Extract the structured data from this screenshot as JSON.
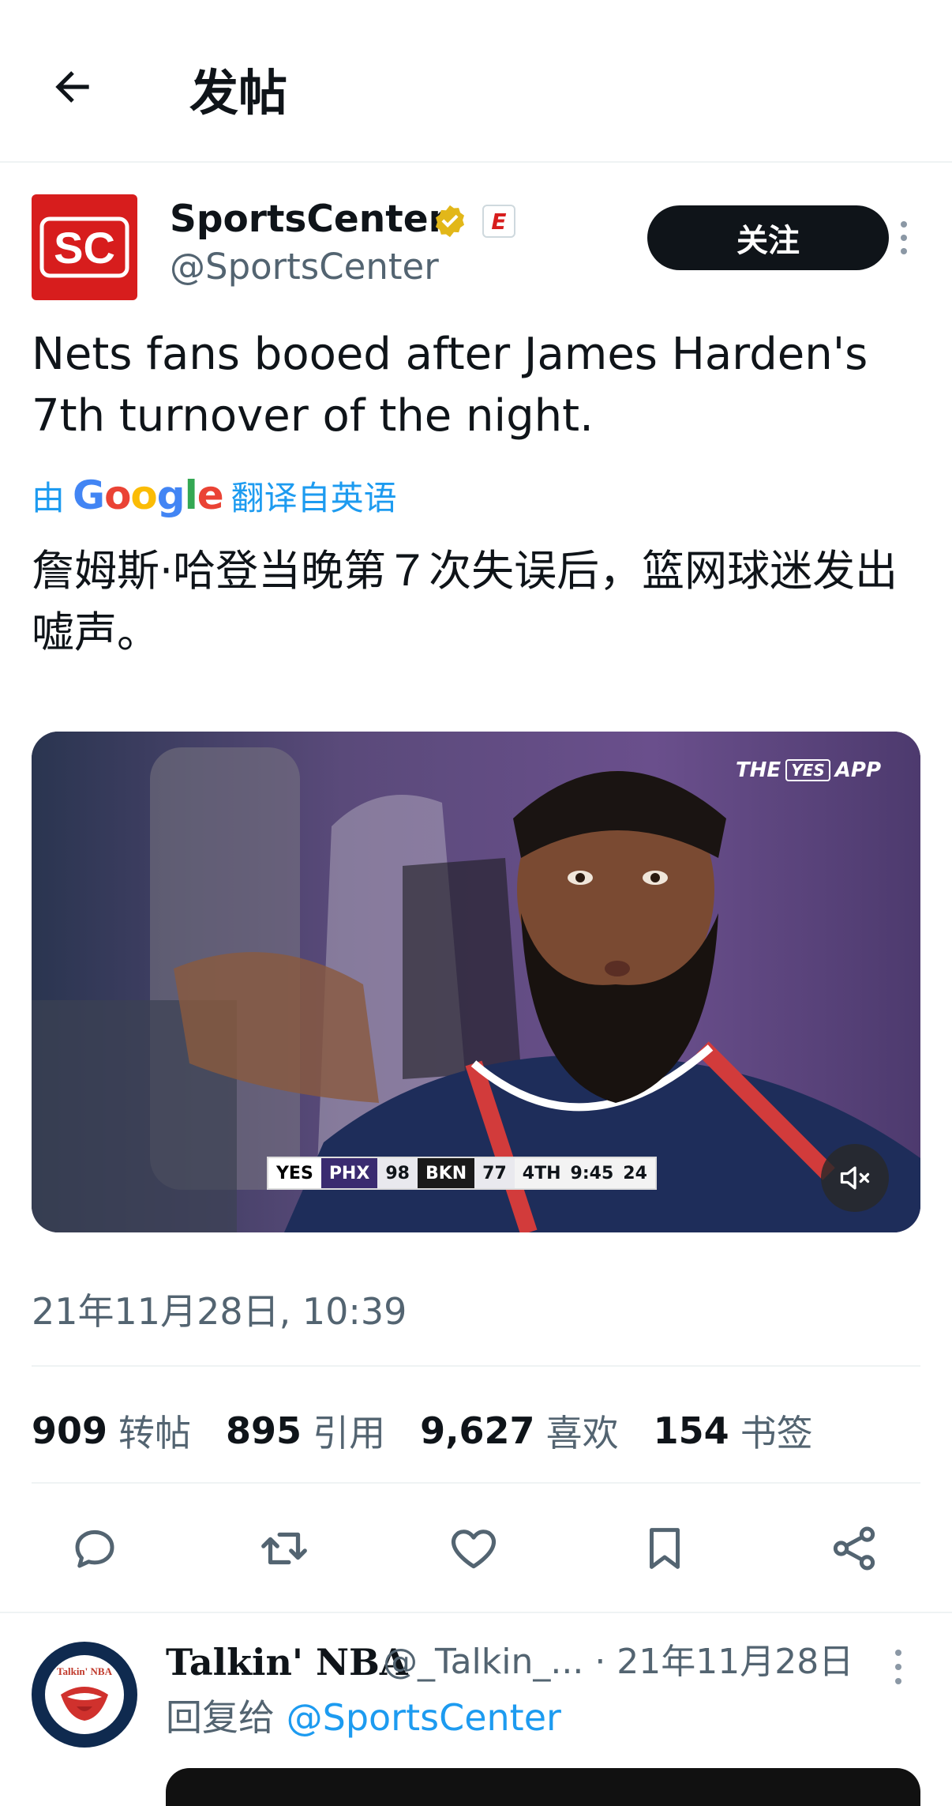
{
  "header": {
    "title": "发帖",
    "back_icon": "arrow-left-icon"
  },
  "tweet": {
    "author": {
      "name": "SportsCenter",
      "handle": "@SportsCenter",
      "avatar_text": "SC",
      "verified_icon": "verified-badge-icon",
      "affiliate_badge": "E"
    },
    "follow_label": "关注",
    "text": "Nets fans booed after James Harden's 7th turnover of the night.",
    "translation": {
      "prefix": "由",
      "provider": "Google",
      "suffix": "翻译自英语",
      "text": "詹姆斯·哈登当晚第７次失误后，篮网球迷发出嘘声。"
    },
    "media": {
      "watermark_the": "THE",
      "watermark_yes": "YES",
      "watermark_app": "APP",
      "scorebug": {
        "network": "YES",
        "team1": "PHX",
        "score1": "98",
        "team2": "BKN",
        "score2": "77",
        "quarter": "4TH",
        "clock": "9:45",
        "shot_clock": "24"
      },
      "mute_icon": "volume-muted-icon"
    },
    "timestamp": "21年11月28日, 10:39",
    "stats": [
      {
        "value": "909",
        "label": "转帖"
      },
      {
        "value": "895",
        "label": "引用"
      },
      {
        "value": "9,627",
        "label": "喜欢"
      },
      {
        "value": "154",
        "label": "书签"
      }
    ],
    "actions": [
      "reply-icon",
      "retweet-icon",
      "like-icon",
      "bookmark-icon",
      "share-icon"
    ]
  },
  "reply": {
    "name": "Talkin' NBA",
    "meta": "@_Talkin_... · 21年11月28日",
    "reply_prefix": "回复给",
    "reply_mention": "@SportsCenter",
    "avatar_text": "Talkin' NBA"
  },
  "colors": {
    "accent": "#1d9bf0",
    "text": "#0f1419",
    "muted": "#536471",
    "brand_red": "#d71d1d"
  }
}
